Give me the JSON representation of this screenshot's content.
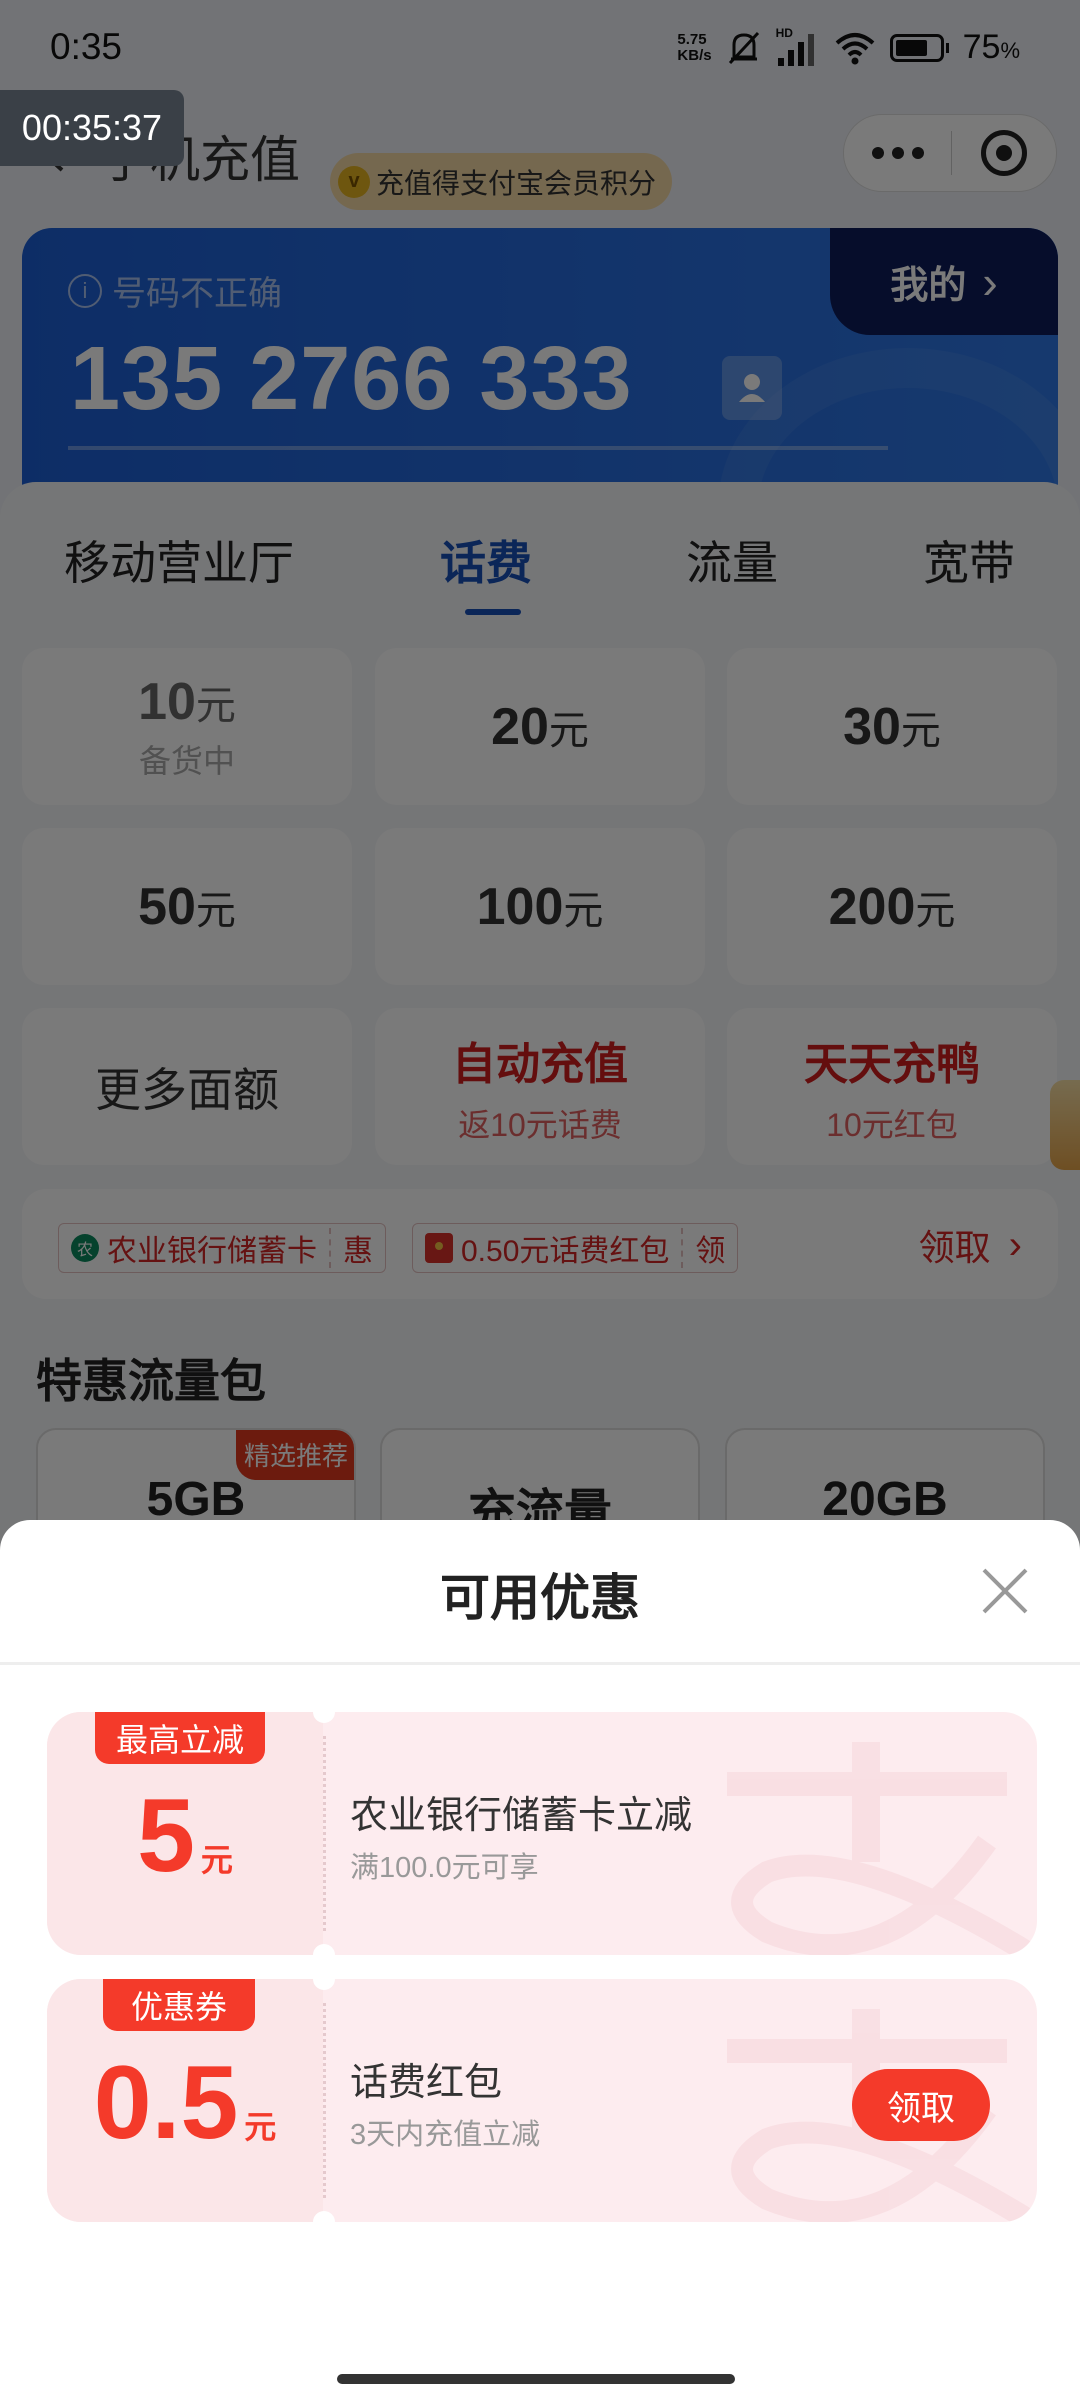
{
  "status_bar": {
    "time": "0:35",
    "net_speed_value": "5.75",
    "net_speed_unit": "KB/s",
    "signal_label": "HD",
    "battery_percent": "75",
    "battery_percent_sign": "%",
    "battery_level": 0.75
  },
  "recording_timer": "00:35:37",
  "nav": {
    "title": "手机充值",
    "points_badge": "充值得支付宝会员积分",
    "points_coin_glyph": "v"
  },
  "phone_card": {
    "warning": "号码不正确",
    "number": "135 2766 333",
    "mine_label": "我的",
    "chevron": "›"
  },
  "tabs": [
    {
      "label": "移动营业厅",
      "active": false
    },
    {
      "label": "话费",
      "active": true
    },
    {
      "label": "流量",
      "active": false
    },
    {
      "label": "宽带",
      "active": false
    }
  ],
  "amounts": [
    {
      "value": "10",
      "unit": "元",
      "sub": "备货中"
    },
    {
      "value": "20",
      "unit": "元"
    },
    {
      "value": "30",
      "unit": "元"
    },
    {
      "value": "50",
      "unit": "元"
    },
    {
      "value": "100",
      "unit": "元"
    },
    {
      "value": "200",
      "unit": "元"
    }
  ],
  "more_amounts": "更多面额",
  "auto_recharge": {
    "title": "自动充值",
    "sub": "返10元话费"
  },
  "daily_duck": {
    "title": "天天充鸭",
    "sub": "10元红包"
  },
  "promo_row": {
    "tag1_label": "农业银行储蓄卡",
    "tag1_suffix": "惠",
    "tag2_label": "0.50元话费红包",
    "tag2_suffix": "领",
    "claim": "领取",
    "chevron": "›"
  },
  "data_section": {
    "title": "特惠流量包",
    "cards": [
      {
        "label": "5GB",
        "badge": "精选推荐"
      },
      {
        "label": "充流量"
      },
      {
        "label": "20GB"
      }
    ]
  },
  "sheet": {
    "title": "可用优惠",
    "coupons": [
      {
        "badge": "最高立减",
        "value": "5",
        "unit": "元",
        "title": "农业银行储蓄卡立减",
        "subtitle": "满100.0元可享"
      },
      {
        "badge": "优惠券",
        "value": "0.5",
        "unit": "元",
        "title": "话费红包",
        "subtitle": "3天内充值立减",
        "action": "领取"
      }
    ]
  },
  "colors": {
    "accent_blue": "#1850b8",
    "coupon_red": "#f43a2a",
    "coupon_bg": "#fdecef"
  }
}
